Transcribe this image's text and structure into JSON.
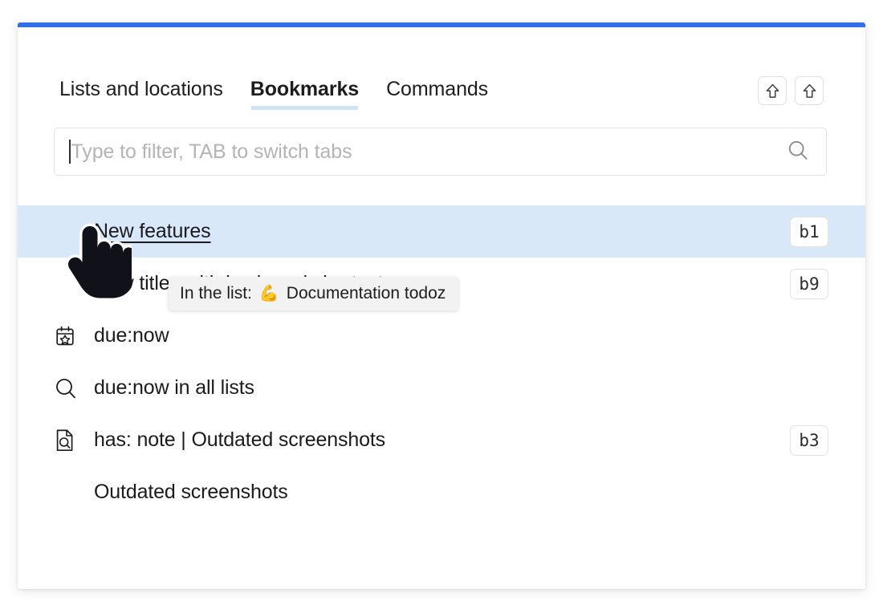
{
  "window": {
    "accent_color": "#3370e8",
    "card_background": "#ffffff"
  },
  "tabs": {
    "items": [
      {
        "label": "Lists and locations",
        "active": false
      },
      {
        "label": "Bookmarks",
        "active": true
      },
      {
        "label": "Commands",
        "active": false
      }
    ],
    "active_underline_color": "#cfe3f7"
  },
  "kbd_buttons": [
    {
      "icon": "shift-arrow-up-icon",
      "label": "⇧"
    },
    {
      "icon": "shift-arrow-up-icon",
      "label": "⇧"
    }
  ],
  "filter": {
    "value": "",
    "placeholder": "Type to filter, TAB to switch tabs",
    "icon": "search-icon"
  },
  "results": [
    {
      "icon": "none",
      "label": "New features",
      "badge": "b1",
      "selected": true,
      "underlined": true
    },
    {
      "icon": "none",
      "label": "New titles with keyboard shortcuts",
      "badge": "b9",
      "selected": false,
      "underlined": false
    },
    {
      "icon": "calendar-star-icon",
      "label": "due:now",
      "badge": "",
      "selected": false,
      "underlined": false
    },
    {
      "icon": "search-icon",
      "label": "due:now in all lists",
      "badge": "",
      "selected": false,
      "underlined": false
    },
    {
      "icon": "document-search-icon",
      "label": "has: note | Outdated screenshots",
      "badge": "b3",
      "selected": false,
      "underlined": false
    },
    {
      "icon": "none",
      "label": "Outdated screenshots",
      "badge": "",
      "selected": false,
      "underlined": false
    }
  ],
  "tooltip": {
    "prefix": "In the list:",
    "emoji": "💪",
    "list_name": "Documentation todoz"
  },
  "cursor": {
    "type": "pointing-hand"
  }
}
